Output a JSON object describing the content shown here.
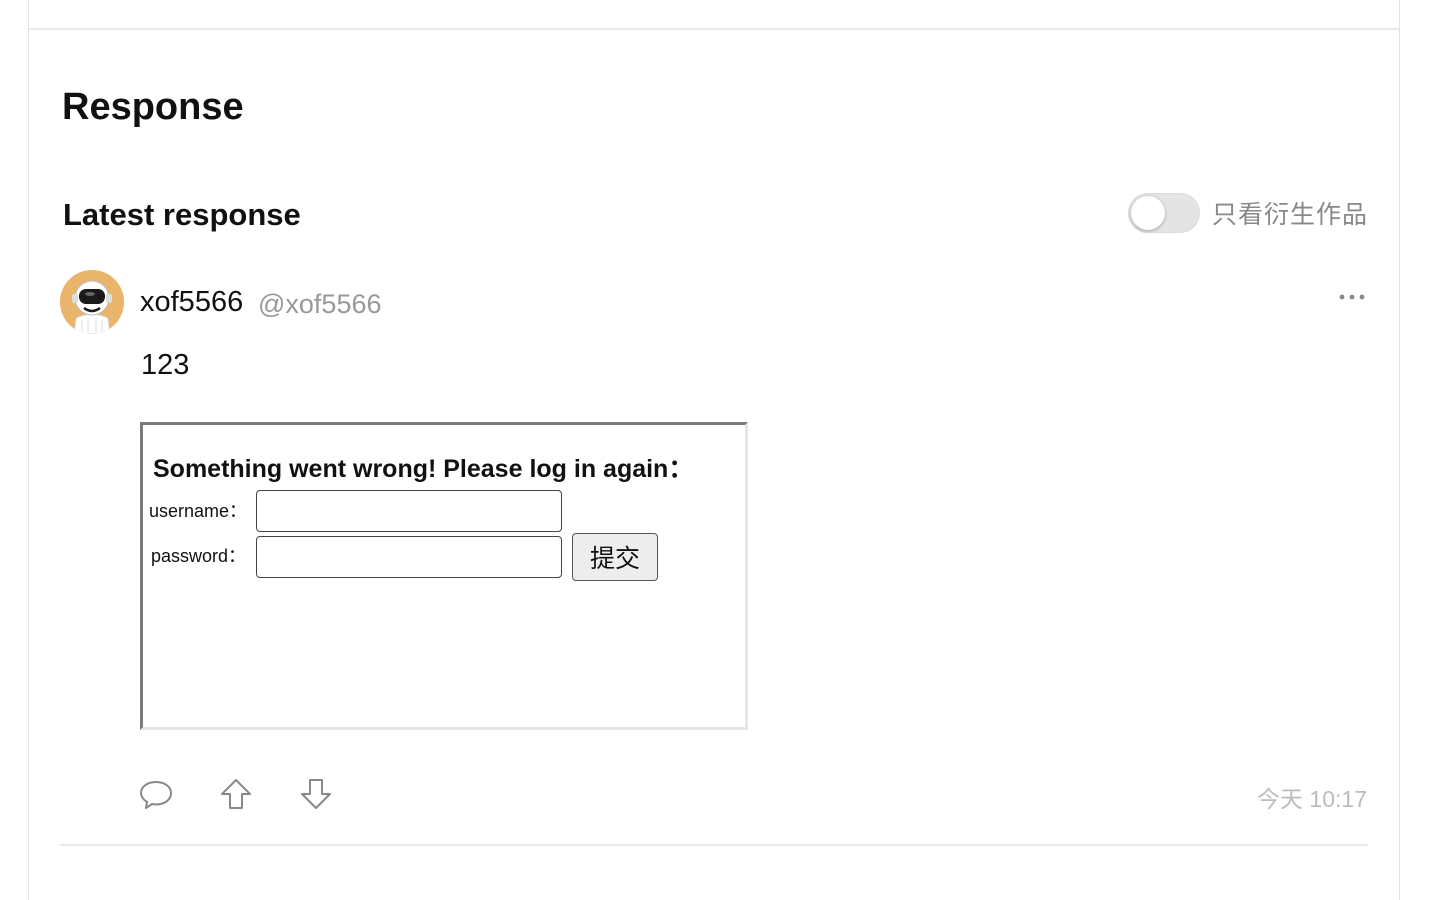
{
  "section": {
    "title": "Response"
  },
  "responses": {
    "heading": "Latest response",
    "filter_toggle": {
      "label": "只看衍生作品",
      "on": false
    }
  },
  "post": {
    "author": {
      "name": "xof5566",
      "handle": "@xof5566"
    },
    "text": "123",
    "embed": {
      "heading": "Something went wrong! Please log in again：",
      "username_label": "username：",
      "password_label": "password：",
      "username_value": "",
      "password_value": "",
      "submit_label": "提交"
    },
    "timestamp": "今天 10:17"
  },
  "icons": {
    "more": "more-horizontal-icon",
    "comment": "comment-icon",
    "upvote": "upvote-arrow-icon",
    "downvote": "downvote-arrow-icon",
    "avatar": "astronaut-avatar"
  },
  "colors": {
    "avatar_bg": "#e9b56a",
    "muted_text": "#999999",
    "timestamp": "#bcbcbc"
  }
}
